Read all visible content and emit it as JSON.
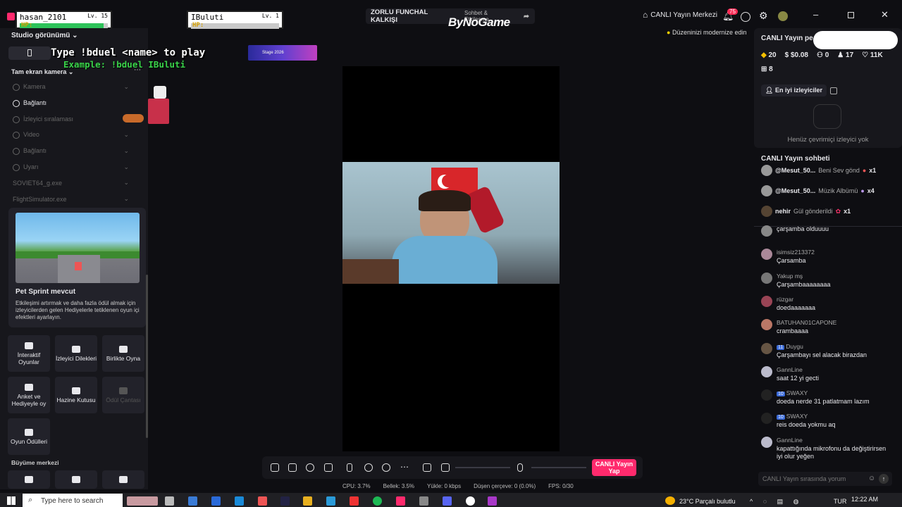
{
  "players": [
    {
      "name": "hasan_2101",
      "level": "Lv. 15",
      "hp_label": "HP:",
      "hp_fraction": 0.95
    },
    {
      "name": "IBuluti",
      "level": "Lv. 1",
      "hp_label": "HP:",
      "hp_fraction": 0.0
    }
  ],
  "stream_title": "ZORLU FUNCHAL KALKIŞI",
  "stream_subtitle": "Sohbet & Etkileşme",
  "watermark": "ByNoGame",
  "top_right": {
    "live_center": "CANLI Yayın Merkezi",
    "notifications_count": "75",
    "modernize_notice": "Düzeninizi modernize edin"
  },
  "overlay": {
    "line1": "Type !bduel <name> to play",
    "line2": "Example: !bduel IBuluti",
    "stage_banner": "Stage 2026"
  },
  "left_panel": {
    "studio_view": "Studio görünümü",
    "fullscreen_camera": "Tam ekran kamera",
    "sources": [
      {
        "label": "Kamera",
        "active": false
      },
      {
        "label": "Bağlantı",
        "active": true
      },
      {
        "label": "İzleyici sıralaması",
        "active": false
      },
      {
        "label": "Video",
        "active": false
      },
      {
        "label": "Bağlantı",
        "active": false
      },
      {
        "label": "Uyarı",
        "active": false
      },
      {
        "label": "SOVIET64_g.exe",
        "active": false
      },
      {
        "label": "FlightSimulator.exe",
        "active": false
      }
    ],
    "promo_title": "Pet Sprint mevcut",
    "promo_text": "Etkileşimi artırmak ve daha fazla ödül almak için izleyicilerden gelen Hediyelerle tetiklenen oyun içi efektleri ayarlayın.",
    "tiles": [
      {
        "label": "İnteraktif Oyunlar",
        "enabled": true
      },
      {
        "label": "İzleyici Dilekleri",
        "enabled": true
      },
      {
        "label": "Birlikte Oyna",
        "enabled": true
      },
      {
        "label": "Anket ve Hediyeyle oy",
        "enabled": true
      },
      {
        "label": "Hazine Kutusu",
        "enabled": true
      },
      {
        "label": "Ödül Çantası",
        "enabled": false
      },
      {
        "label": "Oyun Ödülleri",
        "enabled": true
      }
    ],
    "growth_center": "Büyüme merkezi"
  },
  "go_live_button": "CANLI Yayın Yap",
  "stats_bar": {
    "cpu": "CPU: 3.7%",
    "memory": "Bellek: 3.5%",
    "upload": "Yükle: 0 kbps",
    "dropped": "Düşen çerçeve: 0 (0.0%)",
    "fps": "FPS: 0/30"
  },
  "right_panel": {
    "live_title": "CANLI Yayın pe",
    "stats": {
      "diamonds": "20",
      "money": "$0.08",
      "followers": "0",
      "viewers": "17",
      "likes": "11K",
      "gifts": "8"
    },
    "top_viewers_tab": "En iyi izleyiciler",
    "no_viewers": "Henüz çevrimiçi izleyici yok",
    "chat_title": "CANLI Yayın sohbeti",
    "gift_events": [
      {
        "user": "@Mesut_50...",
        "action": "Beni Sev gönd",
        "count": "x1"
      },
      {
        "user": "@Mesut_50...",
        "action": "Müzik Albümü",
        "count": "x4"
      },
      {
        "user": "nehir",
        "action": "Gül gönderildi",
        "count": "x1"
      }
    ],
    "messages": [
      {
        "user": "",
        "text": "çarşamba olduuuu",
        "badge": ""
      },
      {
        "user": "isimsiz213372",
        "text": "Çarsamba",
        "badge": ""
      },
      {
        "user": "Yakup mş",
        "text": "Çarşambaaaaaaaa",
        "badge": ""
      },
      {
        "user": "rüzgar",
        "text": "doedaaaaaaa",
        "badge": ""
      },
      {
        "user": "BATUHAN01CAPONE",
        "text": "crambaaaa",
        "badge": ""
      },
      {
        "user": "Duygu",
        "text": "Çarşambayı sel alacak birazdan",
        "badge": "11"
      },
      {
        "user": "GannLine",
        "text": "saat 12 yi gecti",
        "badge": ""
      },
      {
        "user": "SWAXY",
        "text": "doeda nerde 31 patlatmam lazım",
        "badge": "10"
      },
      {
        "user": "SWAXY",
        "text": "reis doeda yokmu aq",
        "badge": "10"
      },
      {
        "user": "GannLine",
        "text": "kapattığında mikrofonu da değiştirirsen iyi olur yeğen",
        "badge": ""
      }
    ],
    "chat_placeholder": "CANLI Yayın sırasında yorum"
  },
  "taskbar": {
    "search_placeholder": "Type here to search",
    "weather": "23°C  Parçalı bulutlu",
    "lang": "TUR",
    "time": "12:22 AM"
  }
}
